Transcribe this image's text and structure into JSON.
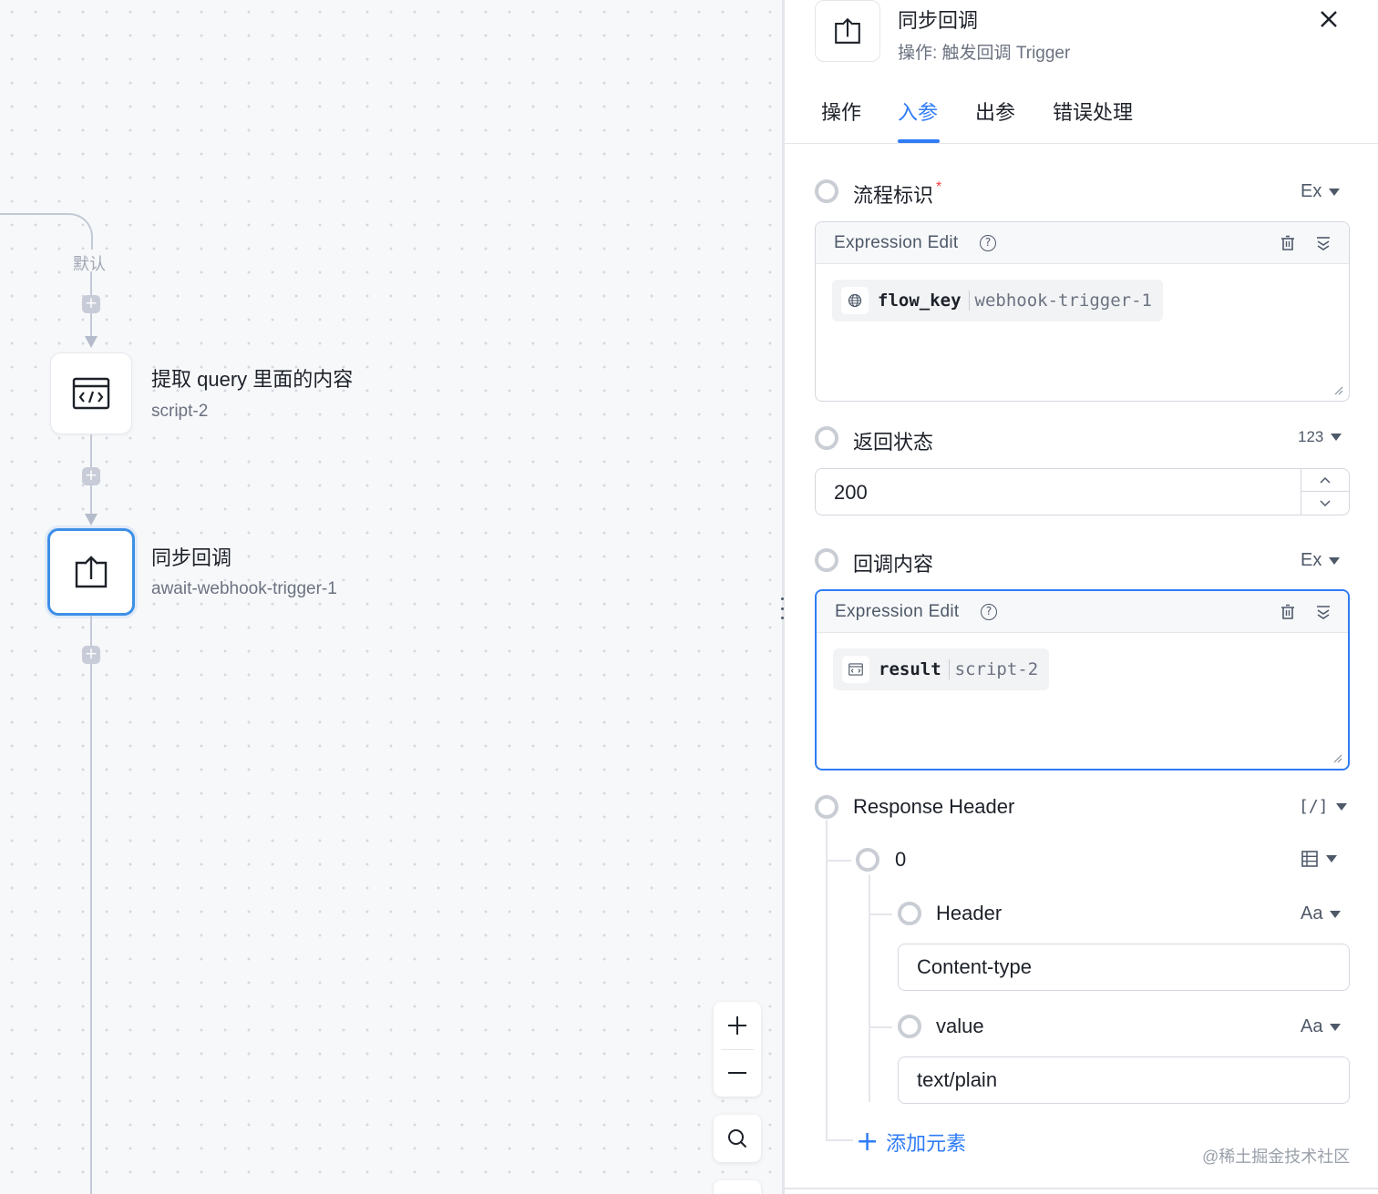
{
  "canvas": {
    "branch_label": "默认",
    "nodes": [
      {
        "title": "提取 query 里面的内容",
        "subtitle": "script-2",
        "icon": "code-icon",
        "active": false
      },
      {
        "title": "同步回调",
        "subtitle": "await-webhook-trigger-1",
        "icon": "upload-icon",
        "active": true
      }
    ],
    "zoom_controls": {
      "zoom_in_icon": "plus-icon",
      "zoom_out_icon": "minus-icon",
      "fit_icon": "search-icon"
    }
  },
  "panel": {
    "header": {
      "title": "同步回调",
      "subtitle": "操作: 触发回调 Trigger",
      "icon": "upload-icon",
      "close_icon": "close-icon"
    },
    "tabs": [
      "操作",
      "入参",
      "出参",
      "错误处理"
    ],
    "active_tab": "入参",
    "fields": {
      "flow_id": {
        "label": "流程标识",
        "required_mark": "*",
        "type_label": "Ex",
        "editor_title": "Expression Edit",
        "chip_key": "flow_key",
        "chip_value": "webhook-trigger-1",
        "chip_icon": "globe-icon"
      },
      "return_status": {
        "label": "返回状态",
        "type_label": "123",
        "value": "200"
      },
      "callback_content": {
        "label": "回调内容",
        "type_label": "Ex",
        "editor_title": "Expression Edit",
        "chip_key": "result",
        "chip_value": "script-2",
        "chip_icon": "code-icon"
      },
      "response_header": {
        "label": "Response Header",
        "type_label": "[/]",
        "item_label": "0",
        "item_type_icon": "table-icon",
        "header_label": "Header",
        "header_type": "Aa",
        "header_value": "Content-type",
        "value_label": "value",
        "value_type": "Aa",
        "value_value": "text/plain",
        "add_label": "添加元素"
      }
    },
    "watermark": "@稀土掘金技术社区"
  },
  "colors": {
    "accent": "#2f7cf6",
    "node_active_border": "#3d8fe6",
    "required": "#f53f3f",
    "canvas_bg": "#f7f8fa"
  }
}
